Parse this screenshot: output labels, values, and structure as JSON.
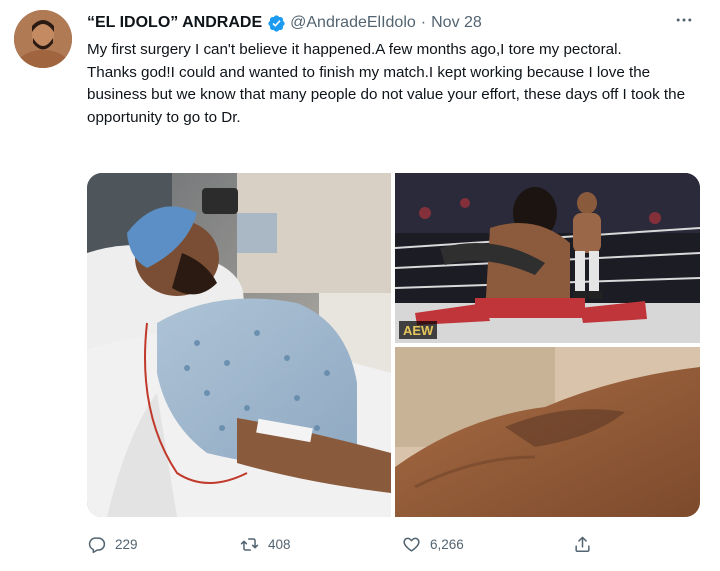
{
  "author": {
    "name": "“EL IDOLO” ANDRADE",
    "handle": "@AndradeElIdolo",
    "separator": "·",
    "date": "Nov 28",
    "verified": true
  },
  "tweet": {
    "lines": [
      "My first surgery  I can't believe it happened.A few months ago,I tore my pectoral.",
      "Thanks god!I could and wanted to finish my match.I kept working because I love the business but we know that many people do not value your effort, these days off I took the opportunity to go to Dr."
    ]
  },
  "media": {
    "wrestling_logo": "AEW"
  },
  "actions": {
    "replies": "229",
    "retweets": "408",
    "likes": "6,266"
  },
  "icons": {
    "verified": "verified-badge-icon",
    "more": "more-icon",
    "reply": "reply-icon",
    "retweet": "retweet-icon",
    "like": "like-icon",
    "share": "share-icon"
  },
  "colors": {
    "accent": "#1d9bf0",
    "muted": "#536471",
    "text": "#0f1419"
  }
}
